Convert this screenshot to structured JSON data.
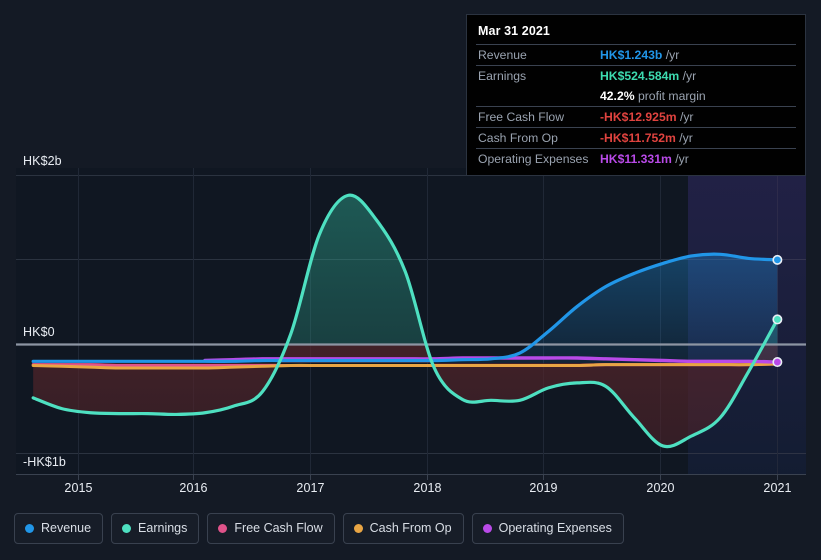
{
  "chart_data": {
    "type": "area",
    "title": "",
    "xlabel": "",
    "ylabel": "",
    "currency": "HKD",
    "grid": true,
    "legend_position": "bottom",
    "ylim": [
      -1.35,
      2.35
    ],
    "ytick_values": [
      2,
      0,
      -1
    ],
    "ytick_labels": [
      "HK$2b",
      "HK$0",
      "-HK$1b"
    ],
    "xlim": [
      2014.6,
      2021.5
    ],
    "xtick_labels": [
      "2015",
      "2016",
      "2017",
      "2018",
      "2019",
      "2020",
      "2021"
    ],
    "x": [
      2014.75,
      2015.0,
      2015.25,
      2015.5,
      2015.75,
      2016.0,
      2016.25,
      2016.5,
      2016.75,
      2017.0,
      2017.25,
      2017.5,
      2017.75,
      2018.0,
      2018.25,
      2018.5,
      2018.75,
      2019.0,
      2019.25,
      2019.5,
      2019.75,
      2020.0,
      2020.25,
      2020.5,
      2020.75,
      2021.0,
      2021.25
    ],
    "series": [
      {
        "name": "Revenue",
        "color": "#2196e8",
        "values": [
          0.02,
          0.02,
          0.02,
          0.02,
          0.02,
          0.02,
          0.02,
          0.02,
          0.03,
          0.03,
          0.03,
          0.03,
          0.03,
          0.03,
          0.03,
          0.04,
          0.05,
          0.12,
          0.38,
          0.68,
          0.92,
          1.08,
          1.2,
          1.29,
          1.31,
          1.26,
          1.243
        ]
      },
      {
        "name": "Earnings",
        "color": "#4ee0c1",
        "values": [
          -0.42,
          -0.55,
          -0.6,
          -0.61,
          -0.61,
          -0.62,
          -0.6,
          -0.52,
          -0.35,
          0.35,
          1.55,
          2.02,
          1.72,
          1.1,
          -0.05,
          -0.44,
          -0.45,
          -0.45,
          -0.3,
          -0.24,
          -0.28,
          -0.66,
          -1.0,
          -0.88,
          -0.66,
          -0.1,
          0.525
        ]
      },
      {
        "name": "Free Cash Flow",
        "color": "#e0538a",
        "values": [
          -0.02,
          -0.02,
          -0.02,
          -0.03,
          -0.03,
          -0.03,
          -0.03,
          -0.03,
          -0.03,
          -0.03,
          -0.03,
          -0.03,
          -0.03,
          -0.03,
          -0.03,
          -0.03,
          -0.03,
          -0.03,
          -0.03,
          -0.03,
          -0.02,
          -0.02,
          -0.02,
          -0.02,
          -0.02,
          -0.02,
          -0.0129
        ]
      },
      {
        "name": "Cash From Op",
        "color": "#e8a544",
        "values": [
          -0.03,
          -0.04,
          -0.05,
          -0.06,
          -0.06,
          -0.06,
          -0.06,
          -0.05,
          -0.04,
          -0.03,
          -0.03,
          -0.03,
          -0.03,
          -0.03,
          -0.03,
          -0.03,
          -0.03,
          -0.03,
          -0.03,
          -0.03,
          -0.02,
          -0.02,
          -0.02,
          -0.02,
          -0.02,
          -0.02,
          -0.0118
        ]
      },
      {
        "name": "Operating Expenses",
        "color": "#b94ae8",
        "values": [
          null,
          null,
          null,
          null,
          null,
          null,
          0.03,
          0.04,
          0.05,
          0.05,
          0.05,
          0.05,
          0.05,
          0.05,
          0.05,
          0.06,
          0.06,
          0.06,
          0.06,
          0.06,
          0.05,
          0.04,
          0.03,
          0.02,
          0.02,
          0.02,
          0.0113
        ]
      }
    ]
  },
  "tooltip": {
    "title": "Mar 31 2021",
    "rows": [
      {
        "label": "Revenue",
        "value": "HK$1.243b",
        "unit": "/yr",
        "color": "#2196e8"
      },
      {
        "label": "Earnings",
        "value": "HK$524.584m",
        "unit": "/yr",
        "color": "#3ddbb0"
      },
      {
        "label": "",
        "margin_value": "42.2%",
        "margin_text": "profit margin"
      },
      {
        "label": "Free Cash Flow",
        "value": "-HK$12.925m",
        "unit": "/yr",
        "color": "#e0433f"
      },
      {
        "label": "Cash From Op",
        "value": "-HK$11.752m",
        "unit": "/yr",
        "color": "#e0433f"
      },
      {
        "label": "Operating Expenses",
        "value": "HK$11.331m",
        "unit": "/yr",
        "color": "#b94ae8"
      }
    ]
  },
  "legend": {
    "items": [
      {
        "label": "Revenue",
        "color": "#2196e8"
      },
      {
        "label": "Earnings",
        "color": "#4ee0c1"
      },
      {
        "label": "Free Cash Flow",
        "color": "#e0538a"
      },
      {
        "label": "Cash From Op",
        "color": "#e8a544"
      },
      {
        "label": "Operating Expenses",
        "color": "#b94ae8"
      }
    ]
  },
  "colors": {
    "background": "#141a25",
    "plot_background": "#101722",
    "grid": "#2b3340",
    "zero_line": "#9aa3b0",
    "tooltip_background": "#010101"
  }
}
